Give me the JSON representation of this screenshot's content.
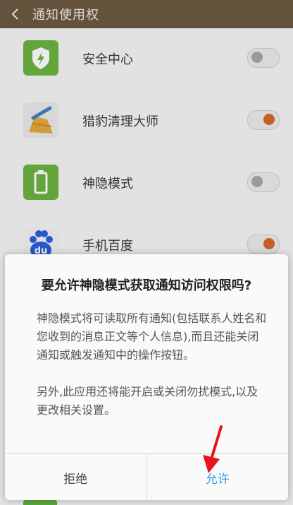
{
  "header": {
    "title": "通知使用权"
  },
  "apps": [
    {
      "name": "安全中心",
      "enabled": false,
      "icon": "security-center-icon"
    },
    {
      "name": "猎豹清理大师",
      "enabled": true,
      "icon": "broom-icon"
    },
    {
      "name": "神隐模式",
      "enabled": false,
      "icon": "battery-icon"
    },
    {
      "name": "手机百度",
      "enabled": true,
      "icon": "baidu-paw-icon"
    }
  ],
  "dialog": {
    "title": "要允许神隐模式获取通知访问权限吗?",
    "body1": "神隐模式将可读取所有通知(包括联系人姓名和您收到的消息正文等个人信息),而且还能关闭通知或触发通知中的操作按钮。",
    "body2": "另外,此应用还将能开启或关闭勿扰模式,以及更改相关设置。",
    "deny": "拒绝",
    "allow": "允许"
  },
  "colors": {
    "header": "#6d5a42",
    "toggle_on": "#d9662a",
    "allow_button": "#2e9de0",
    "annotation_arrow": "#e8141c"
  }
}
